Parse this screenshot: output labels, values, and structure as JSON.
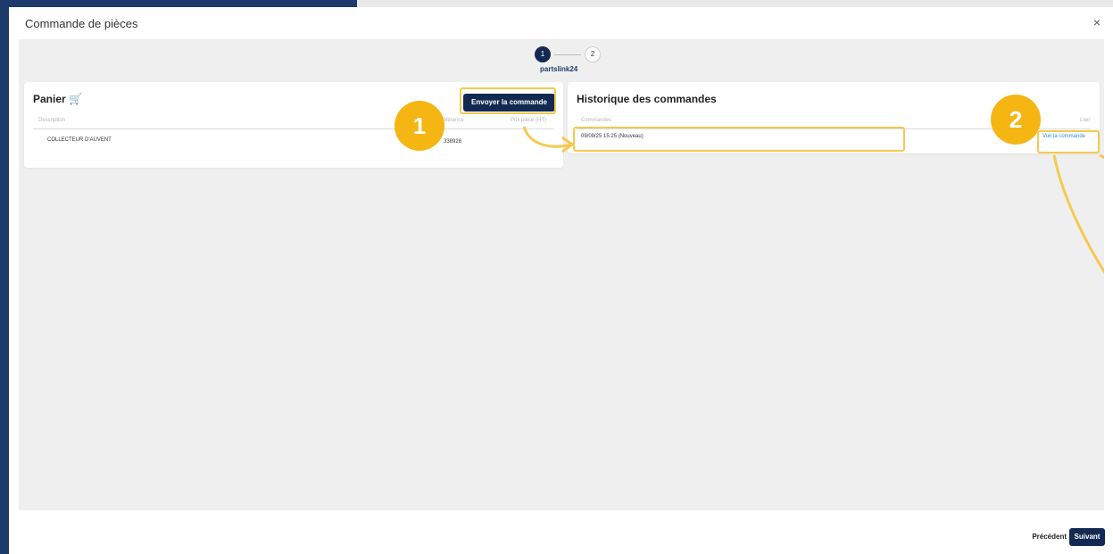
{
  "modal": {
    "title": "Commande de pièces",
    "close_label": "×"
  },
  "stepper": {
    "steps": [
      {
        "label": "1",
        "active": true
      },
      {
        "label": "2",
        "active": false
      }
    ],
    "current_label": "partslink24"
  },
  "cart": {
    "title": "Panier 🛒",
    "send_label": "Envoyer la commande",
    "columns": [
      "Description",
      "Référence",
      "Prix pièce (HT)"
    ],
    "rows": [
      {
        "description": "COLLECTEUR D'AUVENT",
        "reference": "338928"
      }
    ]
  },
  "history": {
    "title": "Historique des commandes",
    "columns": [
      "Commandes",
      "Lien"
    ],
    "rows": [
      {
        "order": "09/09/25 15:25 (Nouveau)",
        "link_label": "Voir la commande"
      }
    ]
  },
  "callouts": {
    "badge_1": "1",
    "badge_2": "2",
    "color": "#f5b614"
  },
  "footer": {
    "prev_label": "Précédent",
    "next_label": "Suivant"
  },
  "colors": {
    "primary": "#122a52",
    "link": "#2d8fd6",
    "highlight": "#f5c94e"
  }
}
